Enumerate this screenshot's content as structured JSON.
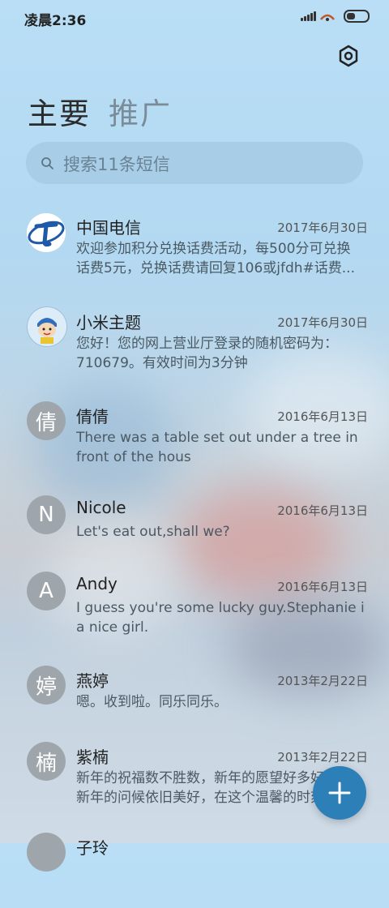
{
  "status_bar": {
    "time": "凌晨2:36"
  },
  "header": {
    "tabs": [
      {
        "label": "主要",
        "active": true
      },
      {
        "label": "推广",
        "active": false
      }
    ]
  },
  "search": {
    "placeholder": "搜索11条短信"
  },
  "conversations": [
    {
      "name": "中国电信",
      "date": "2017年6月30日",
      "avatar": "china-telecom-logo",
      "line1": "欢迎参加积分兑换话费活动，每500分可兑换",
      "line2": "话费5元，兑换话费请回复106或jfdh#话费..."
    },
    {
      "name": "小米主题",
      "date": "2017年6月30日",
      "avatar": "cartoon-avatar",
      "line1": "您好！您的网上营业厅登录的随机密码为：",
      "line2": "710679。有效时间为3分钟"
    },
    {
      "name": "倩倩",
      "date": "2016年6月13日",
      "avatar": "倩",
      "line1": "There was a table set out under a tree in",
      "line2": "front of the hous"
    },
    {
      "name": "Nicole",
      "date": "2016年6月13日",
      "avatar": "N",
      "line1": "Let's eat out,shall we?",
      "line2": ""
    },
    {
      "name": "Andy",
      "date": "2016年6月13日",
      "avatar": "A",
      "line1": "I guess you're some lucky guy.Stephanie is",
      "line2": "a nice girl."
    },
    {
      "name": "燕婷",
      "date": "2013年2月22日",
      "avatar": "婷",
      "line1": "嗯。收到啦。同乐同乐。",
      "line2": ""
    },
    {
      "name": "紫楠",
      "date": "2013年2月22日",
      "avatar": "楠",
      "line1": "新年的祝福数不胜数，新年的愿望好多好多，",
      "line2": "新年的问候依旧美好，在这个温馨的时刻..."
    },
    {
      "name": "子玲",
      "date": "",
      "avatar": "",
      "line1": "",
      "line2": ""
    }
  ],
  "colors": {
    "accent": "#2d7fb8",
    "avatar_gray": "#9fa6ab",
    "telecom_blue": "#1e5aa8"
  }
}
